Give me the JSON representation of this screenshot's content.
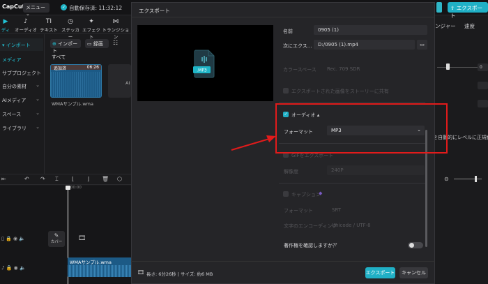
{
  "app": {
    "logo": "CapCut",
    "menu": "メニュー",
    "autosave": "自動保存済: 11:32:12",
    "top_export": "エクスポート",
    "top_export_icon": "upload-icon"
  },
  "toolbar": {
    "items": [
      {
        "label": "ディア",
        "icon": "▶"
      },
      {
        "label": "オーディオ",
        "icon": "♪"
      },
      {
        "label": "テキスト",
        "icon": "TI"
      },
      {
        "label": "ステッカー",
        "icon": "◷"
      },
      {
        "label": "エフェクト",
        "icon": "✦"
      },
      {
        "label": "トランジション",
        "icon": "⋈"
      }
    ]
  },
  "sidebar": {
    "items": [
      {
        "label": "インポート",
        "active": true
      },
      {
        "label": "メディア",
        "active": false
      },
      {
        "label": "サブプロジェクト",
        "active": false
      },
      {
        "label": "自分の素材",
        "chevron": true
      },
      {
        "label": "AIメディア",
        "chevron": true
      },
      {
        "label": "スペース",
        "chevron": true
      },
      {
        "label": "ライブラリ",
        "chevron": true
      }
    ]
  },
  "media": {
    "import_label": "インポート",
    "record_label": "録画",
    "all_label": "すべて",
    "thumb_added": "追加済",
    "thumb_duration": "06:26",
    "thumb_name": "WMAサンプル.wma",
    "ai_label": "AI"
  },
  "timeline": {
    "ruler": "00:00",
    "cover_label": "カバー",
    "clip_label": "WMAサンプル.wma"
  },
  "right_panel": {
    "tab_1": "ンジャー",
    "tab_2": "速度",
    "text_field_1": "0",
    "hint": "を自動的にレベルに正規化しま"
  },
  "dialog": {
    "title": "エクスポート",
    "file_badge": ".MP3",
    "name_label": "名前",
    "name_value": "0905 (1)",
    "export_to_label": "次にエクス...",
    "export_to_value": "D:/0905 (1).mp4",
    "colorspace_label": "カラースペース",
    "colorspace_value": "Rec. 709 SDR",
    "option_text": "エクスポートされた画像をストーリーに共有",
    "audio_label": "オーディオ",
    "audio_chevron": "▴",
    "format_label": "フォーマット",
    "format_value": "MP3",
    "gif_label": "GIFをエクスポート",
    "resolution_label": "解像度",
    "resolution_value": "240P",
    "caption_label": "キャプション",
    "caption_format_label": "フォーマット",
    "caption_format_value": "SRT",
    "encoding_label": "文字のエンコーディング",
    "encoding_value": "Unicode / UTF-8",
    "copyright_label": "著作権を確認しますか？",
    "help_icon": "?",
    "info_text": "長さ: 6分26秒 | サイズ: 約6 MB",
    "export_button": "エクスポート",
    "cancel_button": "キャンセル"
  },
  "colors": {
    "accent": "#20b0c6",
    "annotation": "#e21b1b"
  }
}
